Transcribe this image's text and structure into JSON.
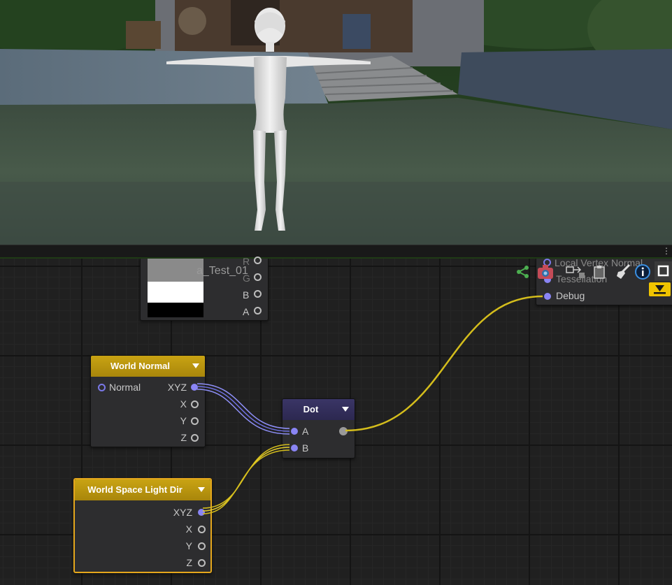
{
  "preview_node": {
    "title_partial": "a_Test_01",
    "ports": [
      "R",
      "G",
      "B",
      "A"
    ]
  },
  "master_node": {
    "ports": [
      "Local Vertex Normal",
      "Tessellation",
      "Debug"
    ]
  },
  "world_normal_node": {
    "title": "World Normal",
    "input": "Normal",
    "outputs": [
      "XYZ",
      "X",
      "Y",
      "Z"
    ]
  },
  "dot_node": {
    "title": "Dot",
    "inputs": [
      "A",
      "B"
    ]
  },
  "light_dir_node": {
    "title": "World Space Light Dir",
    "outputs": [
      "XYZ",
      "X",
      "Y",
      "Z"
    ]
  },
  "toolbar": {
    "icons": [
      "share-icon",
      "camera-icon",
      "shader-icon",
      "clipboard-icon",
      "broom-icon",
      "info-icon",
      "maximize-icon",
      "download-icon"
    ]
  },
  "colors": {
    "wire_yellow": "#d4bd1c",
    "wire_blue": "#7d7ef0",
    "header_yellow": "#c9a313",
    "header_purple": "#3a3566",
    "selection_orange": "#e5a71c"
  }
}
